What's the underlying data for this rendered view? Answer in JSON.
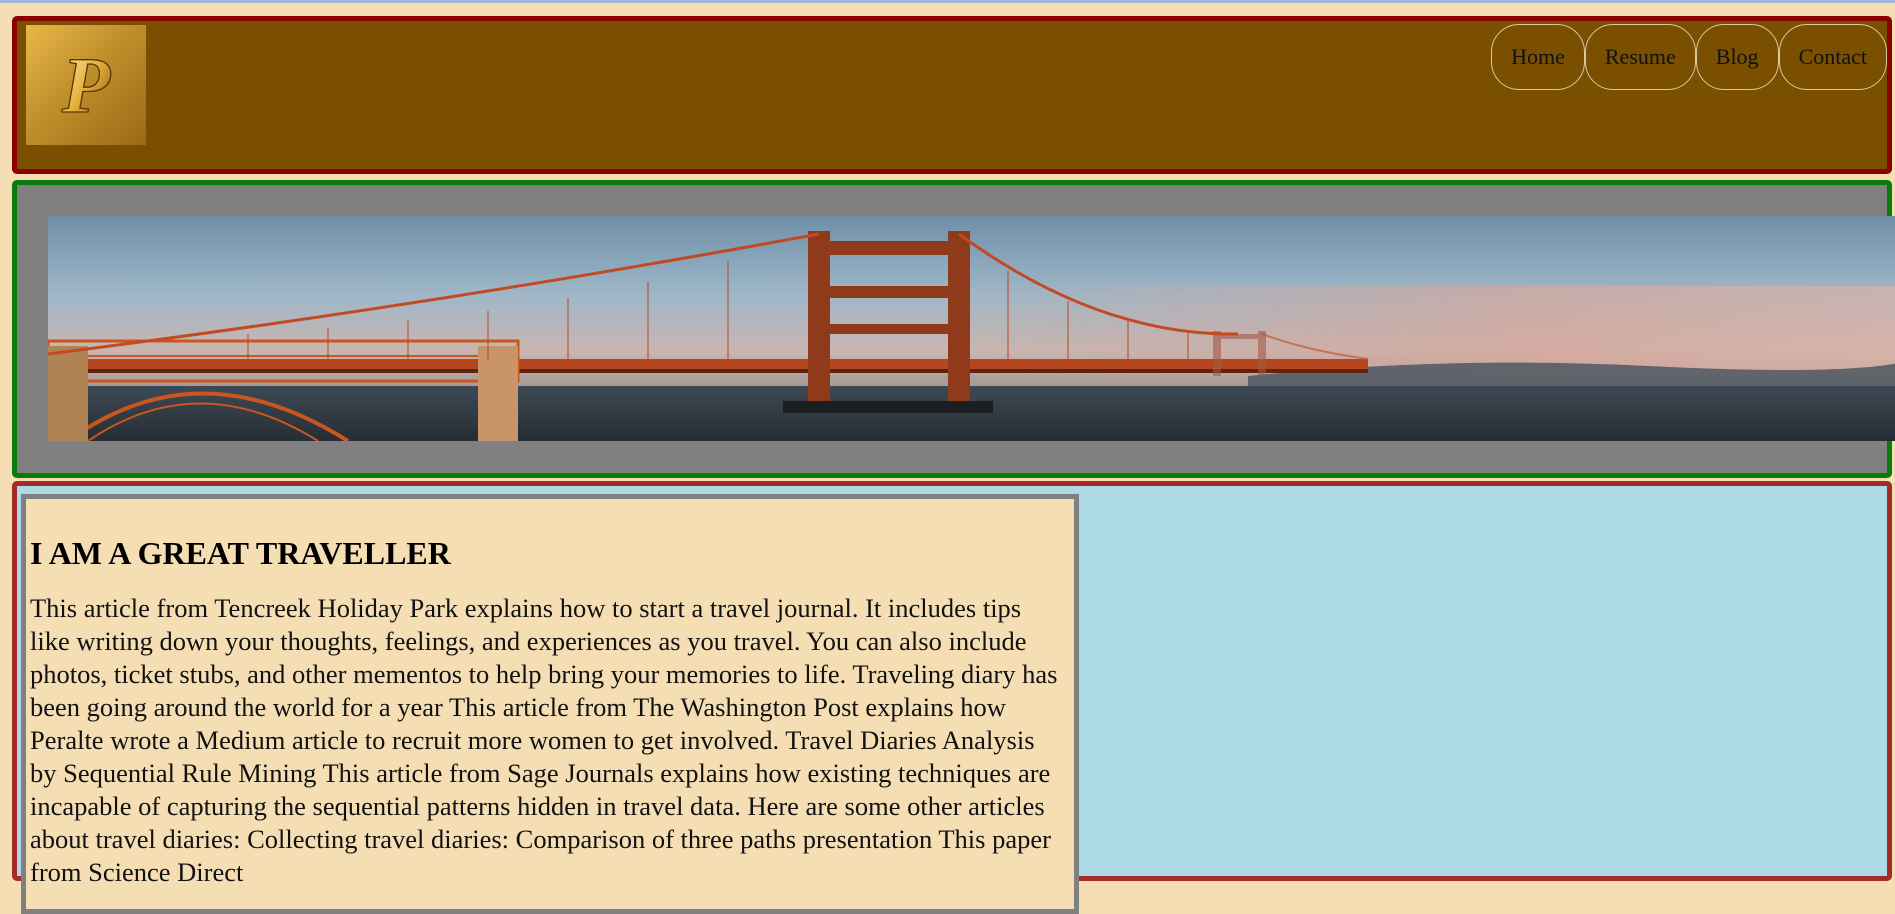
{
  "header": {
    "logo_letter": "P",
    "nav": [
      {
        "label": "Home"
      },
      {
        "label": "Resume"
      },
      {
        "label": "Blog"
      },
      {
        "label": "Contact"
      }
    ]
  },
  "colors": {
    "header_bg": "#7a4f00",
    "header_border": "#8b0000",
    "banner_bg": "#808080",
    "banner_border": "#0a7a0a",
    "content_bg": "#add8e6",
    "content_border": "#a52a2a",
    "article_bg": "#f5deb3"
  },
  "banner": {
    "image_icon": "golden-gate-bridge-photo"
  },
  "article": {
    "title": "I AM A GREAT TRAVELLER",
    "body": "This article from Tencreek Holiday Park explains how to start a travel journal. It includes tips like writing down your thoughts, feelings, and experiences as you travel. You can also include photos, ticket stubs, and other mementos to help bring your memories to life. Traveling diary has been going around the world for a year This article from The Washington Post explains how Peralte wrote a Medium article to recruit more women to get involved. Travel Diaries Analysis by Sequential Rule Mining This article from Sage Journals explains how existing techniques are incapable of capturing the sequential patterns hidden in travel data. Here are some other articles about travel diaries: Collecting travel diaries: Comparison of three paths presentation This paper from Science Direct"
  }
}
